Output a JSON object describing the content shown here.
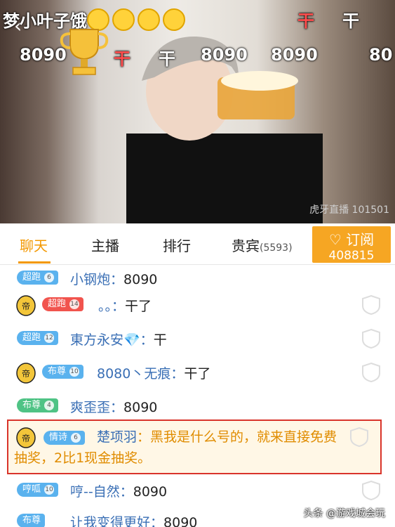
{
  "video": {
    "streamer_text": "梦小叶子饿",
    "danmaku": [
      "8090",
      "干",
      "干",
      "8090",
      "8090",
      "80",
      "干"
    ],
    "watermark": "虎牙直播 101501"
  },
  "tabs": [
    {
      "label": "聊天",
      "active": true
    },
    {
      "label": "主播"
    },
    {
      "label": "排行"
    },
    {
      "label": "贵宾",
      "count": "(5593)"
    }
  ],
  "subscribe": {
    "label": "订阅",
    "count": "408815"
  },
  "chat": [
    {
      "badge": "超跑",
      "level": "6",
      "name": "小钢炮",
      "message": "8090",
      "color": "blue"
    },
    {
      "badge": "超跑",
      "level": "14",
      "name": "。。",
      "message": "干了",
      "color": "red",
      "avatar": true
    },
    {
      "badge": "超跑",
      "level": "12",
      "name": "東方永安💎",
      "message": "干",
      "color": "blue"
    },
    {
      "badge": "布尊",
      "level": "10",
      "name": "8080丶无痕",
      "message": "干了",
      "color": "blue",
      "avatar": true
    },
    {
      "badge": "布尊",
      "level": "4",
      "name": "爽歪歪",
      "message": "8090",
      "color": "green"
    },
    {
      "badge": "哼呱",
      "level": "10",
      "name": "哼--自然",
      "message": "8090",
      "color": "blue"
    },
    {
      "badge": "布尊",
      "level": "",
      "name": "让我变得更好",
      "message": "8090",
      "color": "blue"
    }
  ],
  "highlight": {
    "badge": "情诗",
    "level": "6",
    "name": "楚项羽",
    "message_line1": "黑我是什么号的，就来直接免费",
    "message_line2": "抽奖，2比1现金抽奖。"
  },
  "footer": {
    "watermark": "头条 @游戏城会玩"
  },
  "colors": {
    "accent": "#f39800",
    "subscribe": "#f6a623",
    "name": "#3a6fb5",
    "highlight_border": "#d9342b"
  }
}
